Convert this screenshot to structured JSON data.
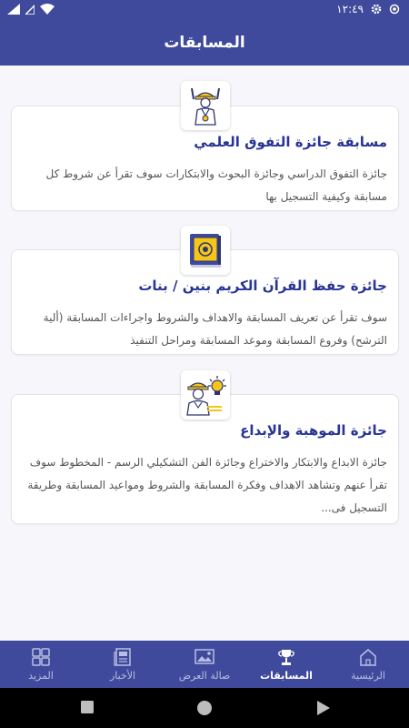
{
  "status_bar": {
    "time": "١٢:٤٩"
  },
  "app_bar": {
    "title": "المسابقات"
  },
  "competitions": [
    {
      "title": "مسابقة جائزة التفوق العلمي",
      "description": "جائزة التفوق الدراسي وجائزة البحوث والابتكارات سوف تقرأ عن شروط كل مسابقة وكيفية التسجيل بها",
      "icon": "student-medal-icon"
    },
    {
      "title": "جائزة حفظ القرآن الكريم بنين / بنات",
      "description": "سوف تقرأ عن تعريف المسابقة والاهداف والشروط واجراءات المسابقة (ألية الترشح) وفروع المسابقة وموعد المسابقة ومراحل التنفيذ",
      "icon": "quran-book-icon"
    },
    {
      "title": "جائزة الموهبة والإبداع",
      "description": "جائزة الابداع والابتكار والاختراع وجائزة الفن التشكيلي الرسم - المخطوط سوف تقرأ عنهم وتشاهد الاهداف وفكرة المسابقة والشروط ومواعيد المسابقة وطريقة التسجيل فى...",
      "icon": "innovator-lightbulb-icon"
    }
  ],
  "bottom_nav": [
    {
      "label": "الرئيسية",
      "icon": "home-icon",
      "active": false
    },
    {
      "label": "المسابقات",
      "icon": "trophy-icon",
      "active": true
    },
    {
      "label": "صالة العرض",
      "icon": "gallery-icon",
      "active": false
    },
    {
      "label": "الأخبار",
      "icon": "news-icon",
      "active": false
    },
    {
      "label": "المزيد",
      "icon": "grid-icon",
      "active": false
    }
  ],
  "colors": {
    "primary": "#3f4a9c",
    "title_text": "#283593",
    "accent_yellow": "#f5c518"
  }
}
